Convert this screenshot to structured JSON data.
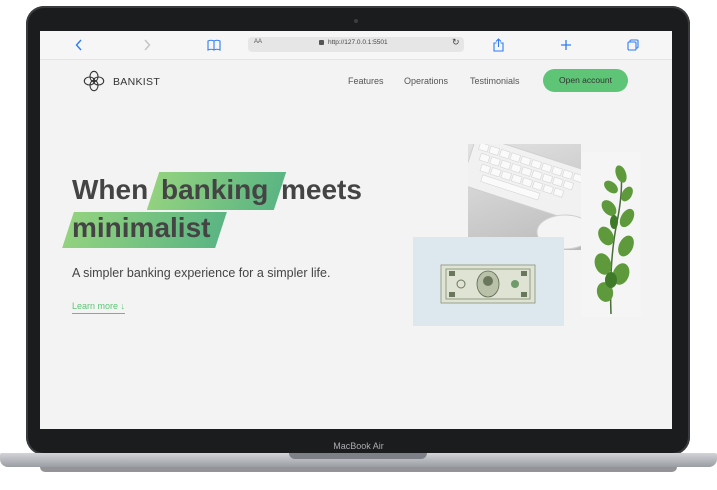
{
  "device": {
    "model_label": "MacBook Air"
  },
  "browser": {
    "text_size_label": "AA",
    "url": "http://127.0.0.1:5501"
  },
  "site": {
    "brand": "BANKIST",
    "nav": {
      "features": "Features",
      "operations": "Operations",
      "testimonials": "Testimonials",
      "cta": "Open account"
    },
    "hero": {
      "title_part1": "When",
      "title_highlight1": "banking",
      "title_part2": "meets",
      "title_highlight2": "minimalist",
      "subtitle": "A simpler banking experience for a simpler life.",
      "learn_more": "Learn more ↓"
    }
  },
  "colors": {
    "accent": "#5ec576",
    "highlight_start": "#92d27f",
    "highlight_end": "#5bb583",
    "text": "#444444",
    "browser_icon": "#2f7cf6"
  },
  "icons": [
    "back-icon",
    "forward-icon",
    "bookmarks-icon",
    "lock-icon",
    "reload-icon",
    "share-icon",
    "new-tab-icon",
    "tabs-icon",
    "bankist-logo-icon"
  ]
}
